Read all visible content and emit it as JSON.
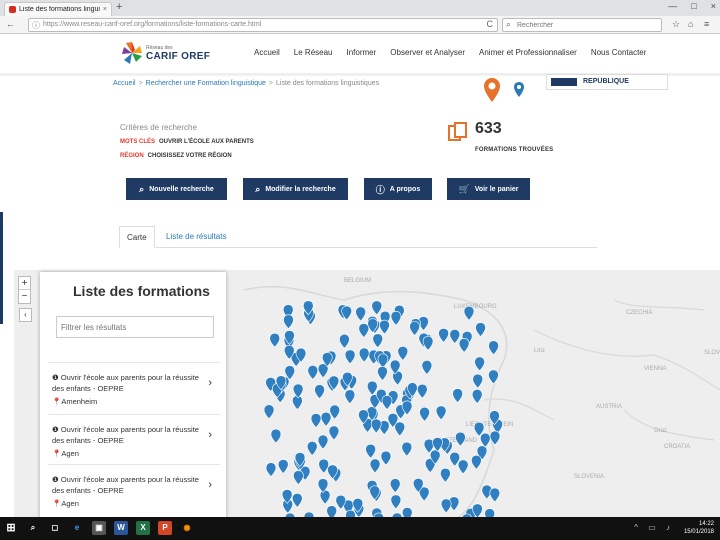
{
  "browser": {
    "tab_title": "Liste des formations linguis...",
    "tab_close": "×",
    "new_tab": "+",
    "url": "https://www.reseau-carif-oref.org/formations/liste-formations-carte.html",
    "search_placeholder": "Rechercher",
    "back_icon": "←",
    "info_icon": "ⓘ",
    "reload_icon": "C",
    "search_icon": "⌕",
    "star_icon": "☆",
    "home_icon": "⌂",
    "menu_icon": "≡",
    "window_controls": [
      "—",
      "□",
      "×"
    ]
  },
  "site": {
    "logo_line1": "Réseau des",
    "logo_line2": "CARIF OREF",
    "nav": [
      "Accueil",
      "Le Réseau",
      "Informer",
      "Observer et Analyser",
      "Animer et Professionnaliser",
      "Nous Contacter"
    ]
  },
  "breadcrumb": {
    "items": [
      "Accueil",
      "Rechercher une Formation linguistique"
    ],
    "current": "Liste des formations linguistiques",
    "separator": ">"
  },
  "gov_badge": "REPUBLIQUE",
  "criteria": {
    "title": "Critères de recherche",
    "keywords_label": "MOTS CLÉS",
    "keywords_value": "OUVRIR L'ÉCOLE AUX PARENTS",
    "region_label": "RÉGION",
    "region_value": "CHOISISSEZ VOTRE RÉGION"
  },
  "results": {
    "count": "633",
    "label": "FORMATIONS TROUVÉES"
  },
  "buttons": {
    "new_search": "Nouvelle recherche",
    "modify_search": "Modifier la recherche",
    "about": "A propos",
    "cart": "Voir le panier"
  },
  "tabs": {
    "map": "Carte",
    "list": "Liste de résultats"
  },
  "map": {
    "zoom_in": "+",
    "zoom_out": "−",
    "collapse": "‹",
    "labels": [
      "BELGIUM",
      "LUXEMBOURG",
      "CZECHIA",
      "SLOVAKIA",
      "VIENNA",
      "AUSTRIA",
      "LIECHTENSTEIN",
      "SWITZERLAND",
      "SLOVENIA",
      "CROATIA",
      "Linz",
      "Graz"
    ],
    "marker_color": "#2f7fc1",
    "land_color": "#eeeeee"
  },
  "panel": {
    "title": "Liste des formations",
    "filter_placeholder": "Filtrer les résultats",
    "items": [
      {
        "title": "Ouvrir l'école aux parents pour la réussite des enfants - OEPRE",
        "location": "Amenheim"
      },
      {
        "title": "Ouvrir l'école aux parents pour la réussite des enfants - OEPRE",
        "location": "Agen"
      },
      {
        "title": "Ouvrir l'école aux parents pour la réussite des enfants - OEPRE",
        "location": "Agen"
      }
    ]
  },
  "taskbar": {
    "time": "14:22",
    "date": "15/01/2018",
    "apps": [
      "⊞",
      "⌕",
      "◻",
      "e",
      "▣",
      "W",
      "X",
      "P",
      "◉"
    ]
  },
  "colors": {
    "navy": "#1f3a63",
    "red": "#e7372c",
    "orange": "#e8712a",
    "link": "#2a7ab5"
  }
}
